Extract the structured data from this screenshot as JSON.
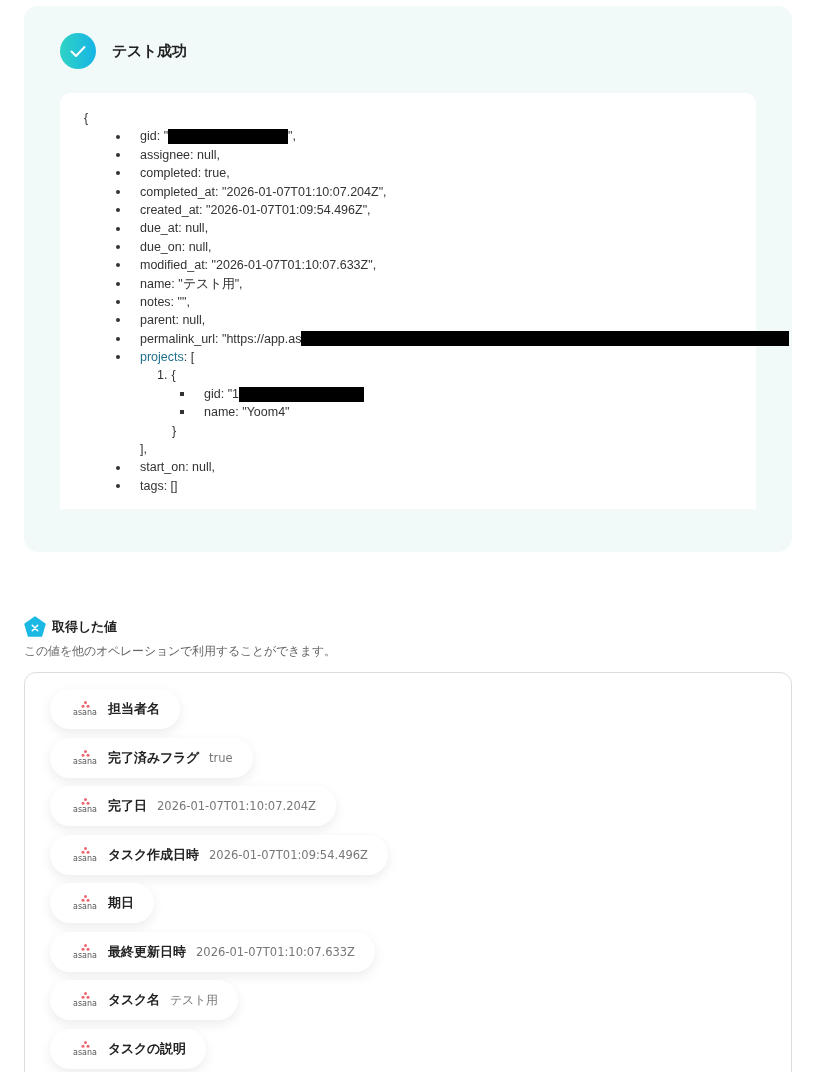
{
  "result": {
    "title": "テスト成功",
    "success": true,
    "code": {
      "open": "{",
      "fields": [
        {
          "kind": "field",
          "text": "gid: \"",
          "redacted": true,
          "after": "\","
        },
        {
          "kind": "field",
          "text": "assignee: null,",
          "redacted": false
        },
        {
          "kind": "field",
          "text": "completed: true,",
          "redacted": false
        },
        {
          "kind": "field",
          "text": "completed_at: \"2026-01-07T01:10:07.204Z\",",
          "redacted": false
        },
        {
          "kind": "field",
          "text": "created_at: \"2026-01-07T01:09:54.496Z\",",
          "redacted": false
        },
        {
          "kind": "field",
          "text": "due_at: null,",
          "redacted": false
        },
        {
          "kind": "field",
          "text": "due_on: null,",
          "redacted": false
        },
        {
          "kind": "field",
          "text": "modified_at: \"2026-01-07T01:10:07.633Z\",",
          "redacted": false
        },
        {
          "kind": "field",
          "text": "name: \"テスト用\",",
          "redacted": false
        },
        {
          "kind": "field",
          "text": "notes: \"\",",
          "redacted": false
        },
        {
          "kind": "field",
          "text": "parent: null,",
          "redacted": false
        },
        {
          "kind": "field",
          "text": "permalink_url: \"https://app.as",
          "redacted": true
        },
        {
          "kind": "array",
          "key": "projects",
          "rest": ": [",
          "items": [
            {
              "marker": "1.",
              "open": "{",
              "fields": [
                {
                  "text": "gid: \"1",
                  "redacted": true
                },
                {
                  "text": "name: \"Yoom4\"",
                  "redacted": false
                }
              ],
              "close": "}"
            }
          ],
          "close": "],"
        },
        {
          "kind": "field",
          "text": "start_on: null,",
          "redacted": false
        },
        {
          "kind": "field",
          "text": "tags: []",
          "redacted": false
        }
      ]
    }
  },
  "values": {
    "title": "取得した値",
    "description": "この値を他のオペレーションで利用することができます。",
    "items": [
      {
        "source": "asana",
        "label": "担当者名"
      },
      {
        "source": "asana",
        "label": "完了済みフラグ",
        "value": "true"
      },
      {
        "source": "asana",
        "label": "完了日",
        "value": "2026-01-07T01:10:07.204Z"
      },
      {
        "source": "asana",
        "label": "タスク作成日時",
        "value": "2026-01-07T01:09:54.496Z"
      },
      {
        "source": "asana",
        "label": "期日"
      },
      {
        "source": "asana",
        "label": "最終更新日時",
        "value": "2026-01-07T01:10:07.633Z"
      },
      {
        "source": "asana",
        "label": "タスク名",
        "value": "テスト用"
      },
      {
        "source": "asana",
        "label": "タスクの説明"
      }
    ]
  }
}
